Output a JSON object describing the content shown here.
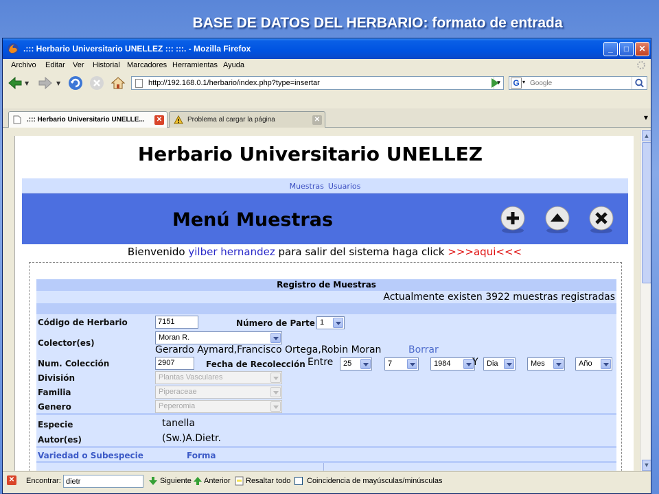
{
  "slide": {
    "title": "BASE DE DATOS DEL HERBARIO: formato de entrada"
  },
  "window": {
    "title": ".::: Herbario Universitario UNELLEZ ::: :::. - Mozilla Firefox"
  },
  "menu": [
    "Archivo",
    "Editar",
    "Ver",
    "Historial",
    "Marcadores",
    "Herramientas",
    "Ayuda"
  ],
  "url": "http://192.168.0.1/herbario/index.php?type=insertar",
  "search": {
    "placeholder": "Google"
  },
  "tabs": [
    {
      "label": ".::: Herbario Universitario UNELLE..."
    },
    {
      "label": "Problema al cargar la página"
    }
  ],
  "page": {
    "site_title": "Herbario Universitario UNELLEZ",
    "nav": [
      "Muestras",
      "Usuarios"
    ],
    "menu_title": "Menú Muestras",
    "welcome": {
      "prefix": "Bienvenido",
      "user": "yilber hernandez",
      "middle": "para salir del sistema haga click",
      "link": ">>>aqui<<<"
    },
    "form": {
      "title": "Registro de Muestras",
      "count_text": "Actualmente existen 3922 muestras registradas",
      "codigo_label": "Código de Herbario",
      "codigo_value": "7151",
      "parte_label": "Número de Parte",
      "parte_value": "1",
      "colector_label": "Colector(es)",
      "colector_value": "Moran R.",
      "colectores_text": "Gerardo Aymard,Francisco Ortega,Robin Moran",
      "borrar_label": "Borrar",
      "num_coleccion_label": "Num. Colección",
      "num_coleccion_value": "2907",
      "fecha_label": "Fecha de Recolección",
      "entre_label": "Entre",
      "dia1": "25",
      "mes1": "7",
      "anio1": "1984",
      "y_label": "Y",
      "dia2": "Dia",
      "mes2": "Mes",
      "anio2": "Año",
      "division_label": "División",
      "division_value": "Plantas Vasculares",
      "familia_label": "Familia",
      "familia_value": "Piperaceae",
      "genero_label": "Genero",
      "genero_value": "Peperomia",
      "especie_label": "Especie",
      "especie_value": "tanella",
      "autor_label": "Autor(es)",
      "autor_value": "(Sw.)A.Dietr.",
      "variedad_label": "Variedad o Subespecie",
      "forma_label": "Forma"
    }
  },
  "findbar": {
    "label": "Encontrar:",
    "value": "dietr",
    "next": "Siguiente",
    "prev": "Anterior",
    "highlight": "Resaltar todo",
    "match_case": "Coincidencia de mayúsculas/minúsculas"
  },
  "icons": {
    "back": "back-arrow-icon",
    "forward": "forward-arrow-icon",
    "reload": "reload-icon",
    "stop": "stop-icon",
    "home": "home-icon",
    "go": "go-arrow-icon",
    "search": "magnifier-icon",
    "add": "plus-icon",
    "up": "up-arrow-icon",
    "delete": "x-icon"
  },
  "colors": {
    "menu_band": "#4c6fe0",
    "form_band": "#d7e4ff",
    "link_red": "#e01212",
    "user_blue": "#2929c9"
  }
}
